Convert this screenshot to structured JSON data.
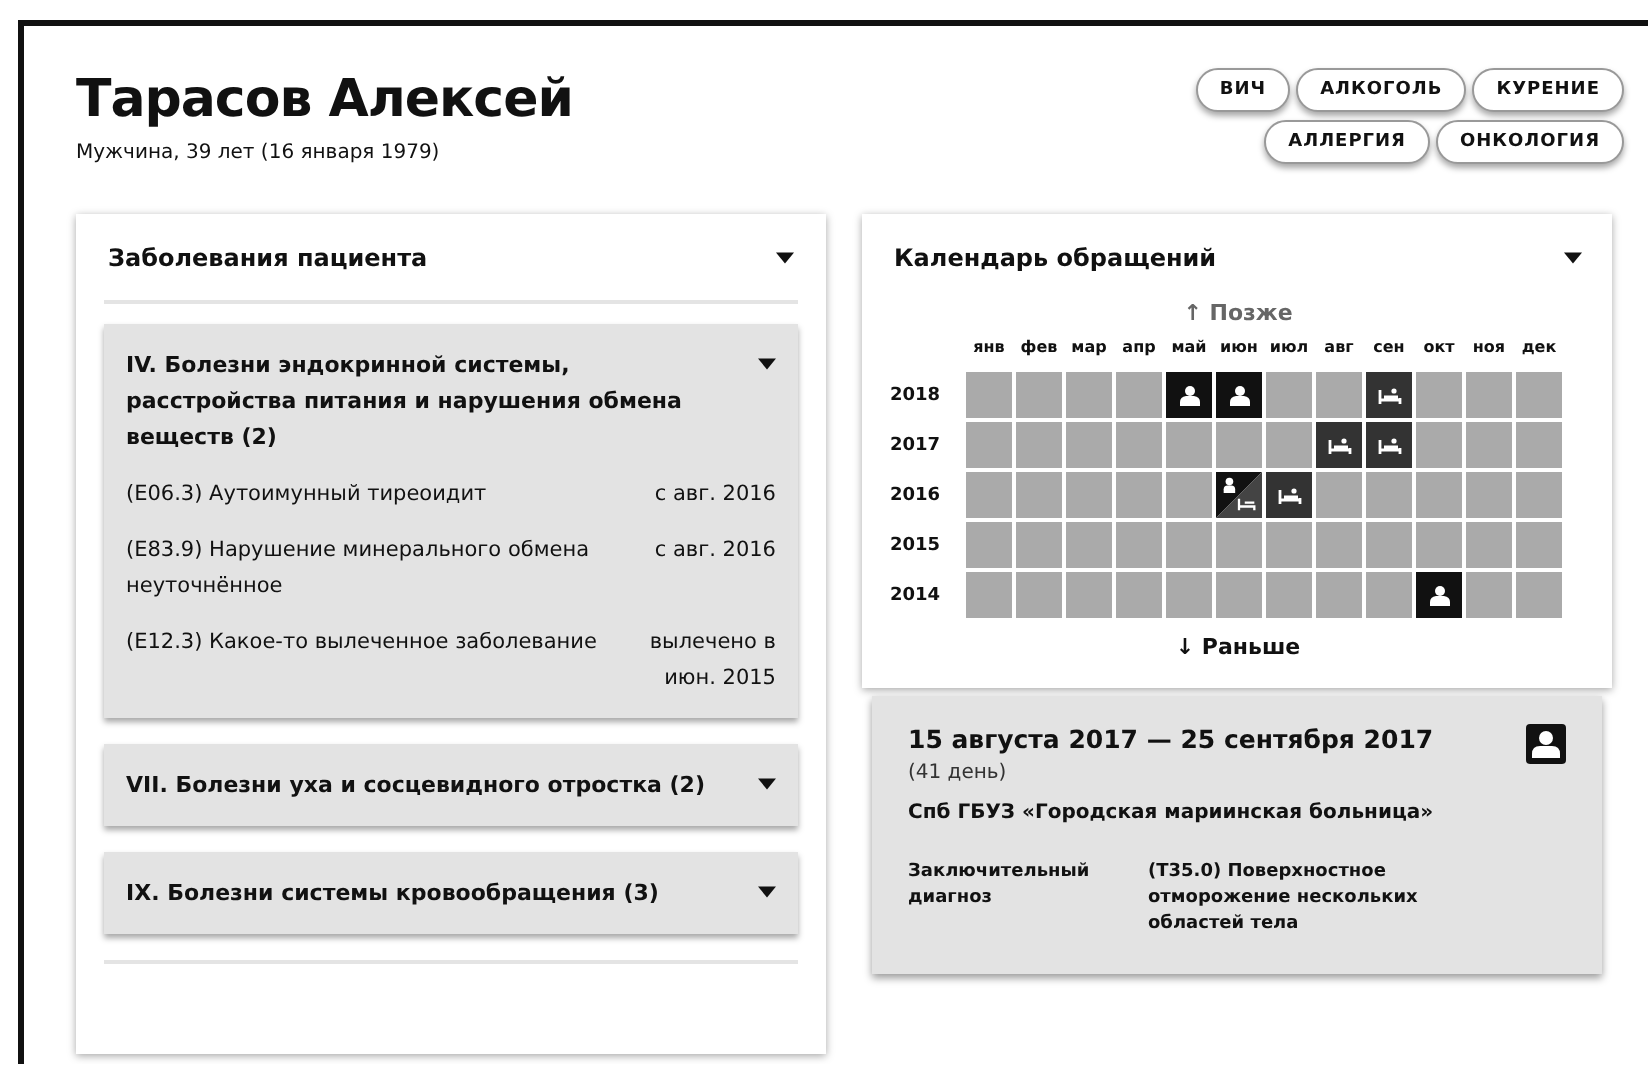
{
  "patient": {
    "name": "Тарасов Алексей",
    "details": "Мужчина, 39 лет (16 января 1979)"
  },
  "tags": [
    [
      "ВИЧ",
      "АЛКОГОЛЬ",
      "КУРЕНИЕ"
    ],
    [
      "АЛЛЕРГИЯ",
      "ОНКОЛОГИЯ"
    ]
  ],
  "diseases": {
    "title": "Заболевания пациента",
    "groups": [
      {
        "title": "IV. Болезни эндокринной системы, расстройства питания и нарушения обмена веществ (2)",
        "items": [
          {
            "name": "(E06.3) Аутоимунный тиреоидит",
            "status": "с авг. 2016"
          },
          {
            "name": "(E83.9) Нарушение минерального обмена неуточнённое",
            "status": "с авг. 2016"
          },
          {
            "name": "(E12.3) Какое-то вылеченное заболевание",
            "status": "вылечено в июн. 2015"
          }
        ]
      },
      {
        "title": "VII. Болезни уха и сосцевидного отростка (2)"
      },
      {
        "title": "IX. Болезни системы кровообращения (3)"
      }
    ]
  },
  "calendar": {
    "title": "Календарь обращений",
    "later": "↑ Позже",
    "earlier": "↓ Раньше",
    "months": [
      "янв",
      "фев",
      "мар",
      "апр",
      "май",
      "июн",
      "июл",
      "авг",
      "сен",
      "окт",
      "ноя",
      "дек"
    ],
    "rows": [
      {
        "year": "2018",
        "cells": [
          {
            "kind": "none"
          },
          {
            "kind": "none"
          },
          {
            "kind": "none"
          },
          {
            "kind": "none"
          },
          {
            "kind": "outpatient"
          },
          {
            "kind": "outpatient"
          },
          {
            "kind": "none"
          },
          {
            "kind": "none"
          },
          {
            "kind": "inpatient"
          },
          {
            "kind": "none"
          },
          {
            "kind": "none"
          },
          {
            "kind": "none"
          }
        ]
      },
      {
        "year": "2017",
        "cells": [
          {
            "kind": "none"
          },
          {
            "kind": "none"
          },
          {
            "kind": "none"
          },
          {
            "kind": "none"
          },
          {
            "kind": "none"
          },
          {
            "kind": "none"
          },
          {
            "kind": "none"
          },
          {
            "kind": "inpatient"
          },
          {
            "kind": "inpatient"
          },
          {
            "kind": "none"
          },
          {
            "kind": "none"
          },
          {
            "kind": "none"
          }
        ]
      },
      {
        "year": "2016",
        "cells": [
          {
            "kind": "none"
          },
          {
            "kind": "none"
          },
          {
            "kind": "none"
          },
          {
            "kind": "none"
          },
          {
            "kind": "none"
          },
          {
            "kind": "mixed"
          },
          {
            "kind": "inpatient"
          },
          {
            "kind": "none"
          },
          {
            "kind": "none"
          },
          {
            "kind": "none"
          },
          {
            "kind": "none"
          },
          {
            "kind": "none"
          }
        ]
      },
      {
        "year": "2015",
        "cells": [
          {
            "kind": "none"
          },
          {
            "kind": "none"
          },
          {
            "kind": "none"
          },
          {
            "kind": "none"
          },
          {
            "kind": "none"
          },
          {
            "kind": "none"
          },
          {
            "kind": "none"
          },
          {
            "kind": "none"
          },
          {
            "kind": "none"
          },
          {
            "kind": "none"
          },
          {
            "kind": "none"
          },
          {
            "kind": "none"
          }
        ]
      },
      {
        "year": "2014",
        "cells": [
          {
            "kind": "none"
          },
          {
            "kind": "none"
          },
          {
            "kind": "none"
          },
          {
            "kind": "none"
          },
          {
            "kind": "none"
          },
          {
            "kind": "none"
          },
          {
            "kind": "none"
          },
          {
            "kind": "none"
          },
          {
            "kind": "none"
          },
          {
            "kind": "outpatient"
          },
          {
            "kind": "none"
          },
          {
            "kind": "none"
          }
        ]
      }
    ]
  },
  "visit": {
    "kind": "outpatient",
    "dates": "15 августа 2017 — 25 сентября 2017",
    "duration": "(41 день)",
    "facility": "Спб ГБУЗ «Городская мариинская больница»",
    "diagnosis_label": "Заключительный диагноз",
    "diagnosis": "(T35.0) Поверхностное отморожение нескольких областей тела"
  }
}
